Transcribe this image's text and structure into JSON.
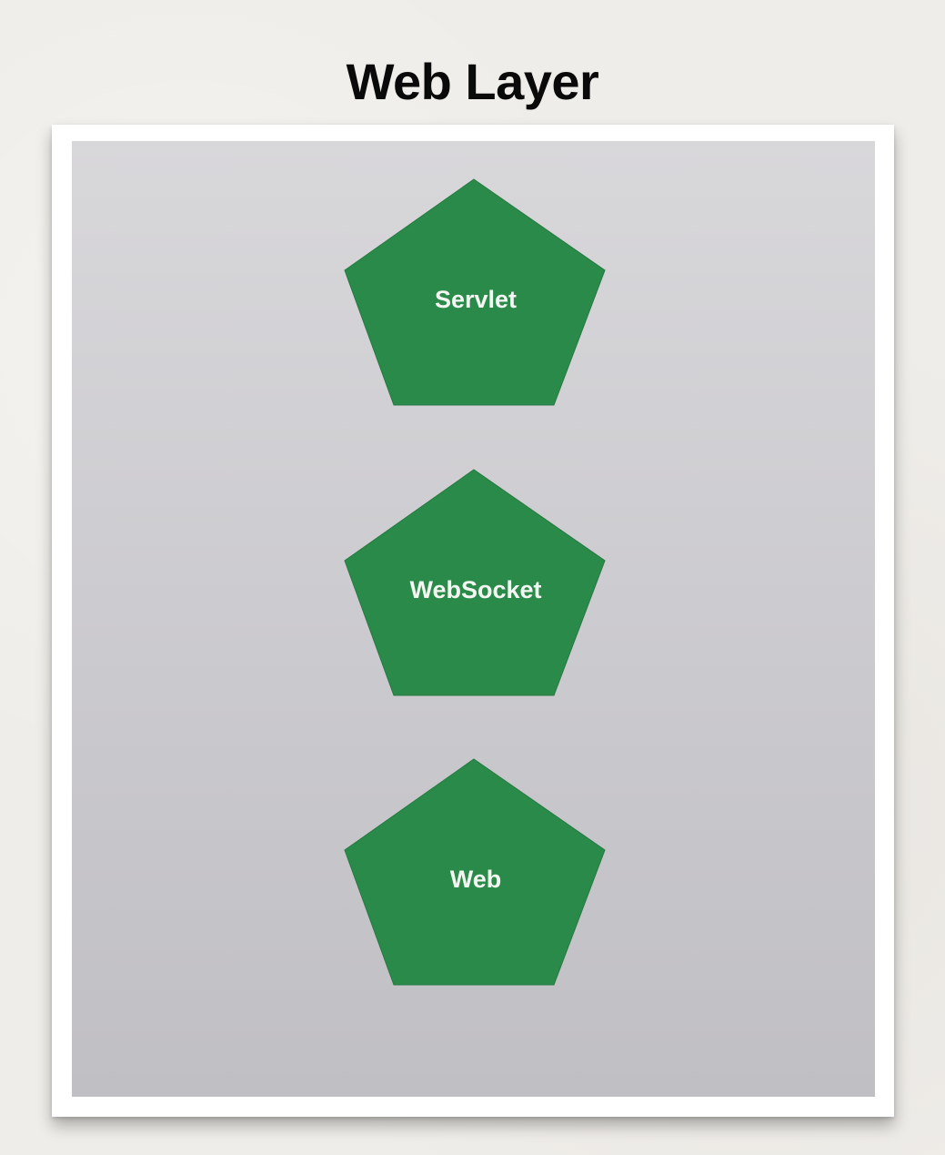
{
  "title": "Web Layer",
  "colors": {
    "background": "#efede9",
    "panel": "#cdccd0",
    "shape_fill": "#2a8a4a",
    "shape_text": "#f4f6f2",
    "title_text": "#0a0a0a"
  },
  "shapes": [
    {
      "label": "Servlet",
      "shape": "pentagon"
    },
    {
      "label": "WebSocket",
      "shape": "pentagon"
    },
    {
      "label": "Web",
      "shape": "pentagon"
    }
  ]
}
